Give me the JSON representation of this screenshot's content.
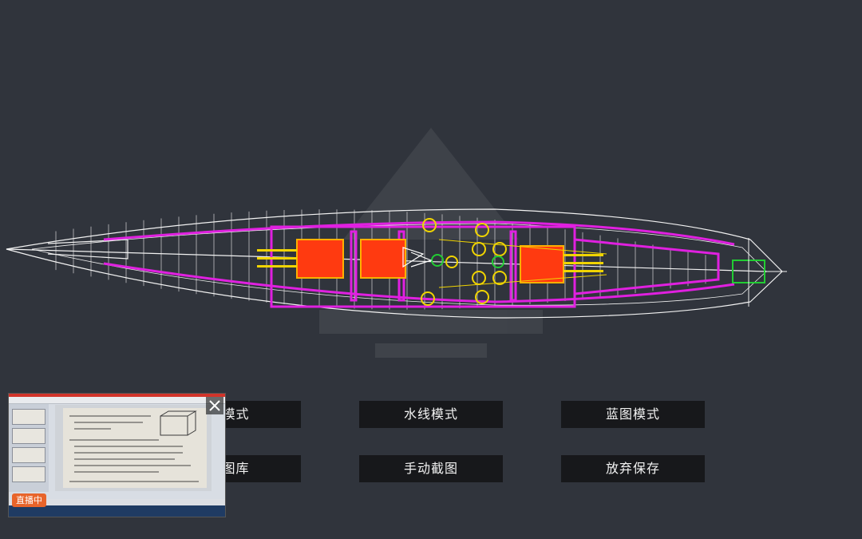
{
  "view": {
    "title": "ship wireframe viewport",
    "colors": {
      "background": "#30343c",
      "hull": "#f2f2f2",
      "structure": "#e020e0",
      "turret": "#ff3a10",
      "equipment": "#f0d400",
      "fittings": "#22cc33"
    }
  },
  "buttons": {
    "normal_mode": "常模式",
    "waterline_mode": "水线模式",
    "blueprint_mode": "蓝图模式",
    "save_gallery": "存图库",
    "manual_capture": "手动截图",
    "discard_save": "放弃保存"
  },
  "pip": {
    "badge": "直播中",
    "close_icon": "close-icon"
  }
}
